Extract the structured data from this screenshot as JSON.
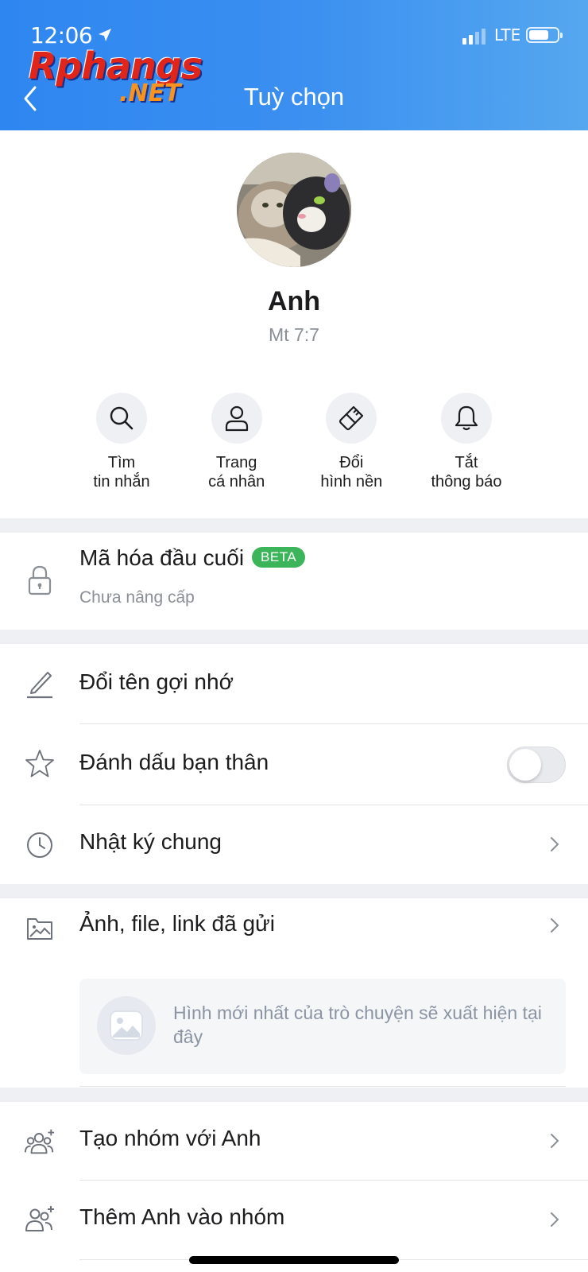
{
  "status_bar": {
    "time": "12:06",
    "network": "LTE"
  },
  "logo": {
    "top": "Rphangs",
    "bottom": ".NET"
  },
  "header": {
    "title": "Tuỳ chọn"
  },
  "profile": {
    "name": "Anh",
    "subtitle": "Mt 7:7"
  },
  "actions": [
    {
      "line1": "Tìm",
      "line2": "tin nhắn",
      "icon": "search-icon"
    },
    {
      "line1": "Trang",
      "line2": "cá nhân",
      "icon": "person-icon"
    },
    {
      "line1": "Đổi",
      "line2": "hình nền",
      "icon": "paintbrush-icon"
    },
    {
      "line1": "Tắt",
      "line2": "thông báo",
      "icon": "bell-icon"
    }
  ],
  "encryption": {
    "label": "Mã hóa đầu cuối",
    "badge": "BETA",
    "status": "Chưa nâng cấp"
  },
  "menu": {
    "rename": "Đổi tên gợi nhớ",
    "best_friend": "Đánh dấu bạn thân",
    "best_friend_on": false,
    "journal": "Nhật ký chung",
    "media": "Ảnh, file, link đã gửi",
    "media_empty": "Hình mới nhất của trò chuyện sẽ xuất hiện tại đây",
    "create_group": "Tạo nhóm với Anh",
    "add_to_group": "Thêm Anh vào nhóm"
  },
  "colors": {
    "header_start": "#2e86f0",
    "header_end": "#55a7ef",
    "beta_badge": "#3cb45a"
  }
}
